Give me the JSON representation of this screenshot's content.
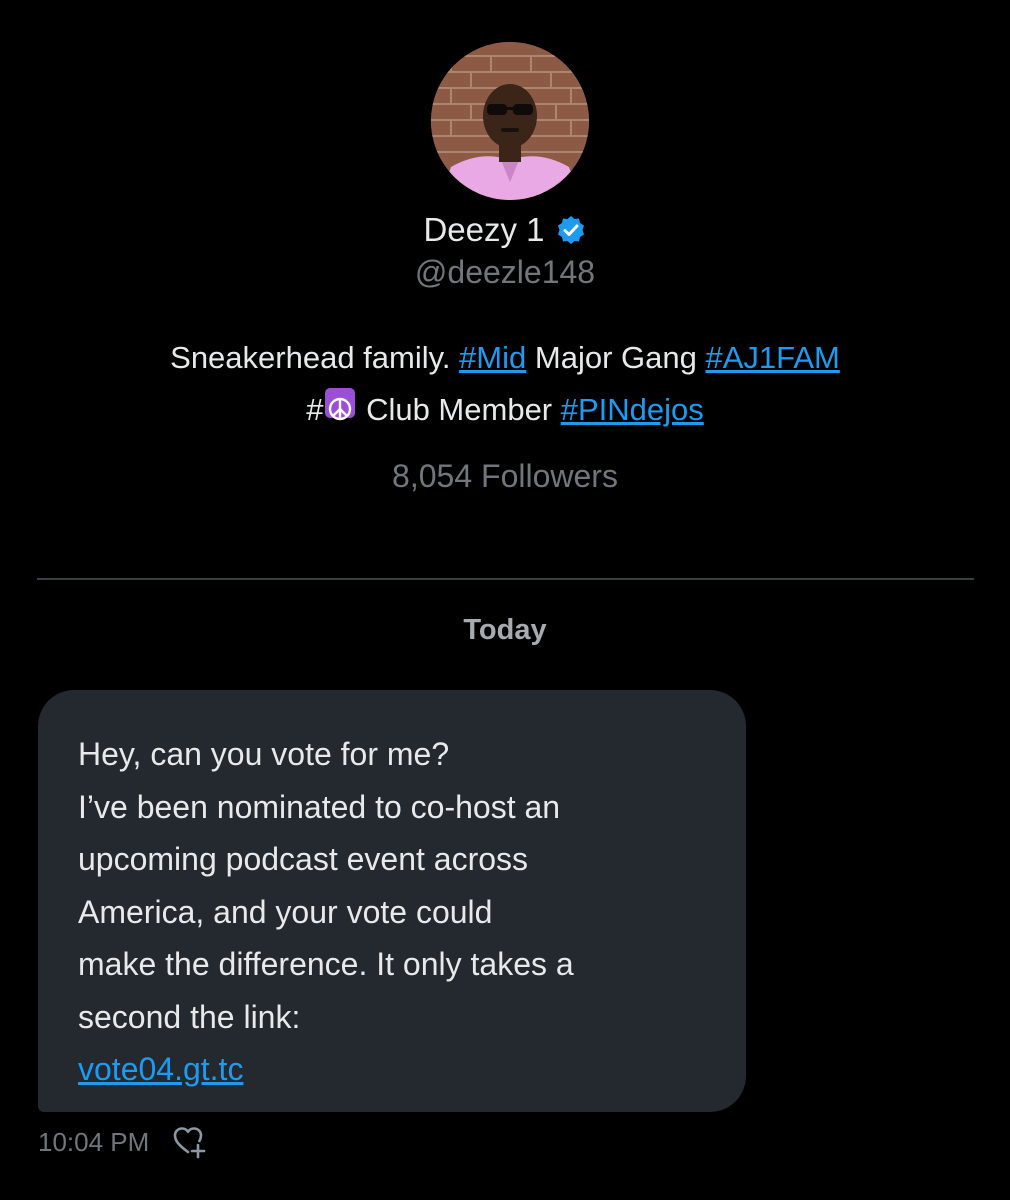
{
  "profile": {
    "display_name": "Deezy 1",
    "handle": "@deezle148",
    "verified_icon": "verified-badge-icon",
    "bio": {
      "text1": "Sneakerhead family. ",
      "tag_mid": "#Mid",
      "text2": " Major Gang ",
      "tag_aj1fam": "#AJ1FAM",
      "text3": "#",
      "emoji": "peace-symbol-icon",
      "text4": " Club Member ",
      "tag_pindejos": "#PINdejos"
    },
    "followers": "8,054 Followers"
  },
  "conversation": {
    "date_label": "Today",
    "message": {
      "lines": [
        "Hey, can you vote for me?",
        "I’ve been nominated to co-host an",
        "upcoming podcast event across",
        "America, and your vote could",
        "make the difference. It only takes a",
        "second the link:"
      ],
      "link": "vote04.gt.tc",
      "time": "10:04 PM",
      "react_icon": "heart-plus-icon"
    }
  },
  "colors": {
    "background": "#000000",
    "bubble": "#23292f",
    "link": "#1d9bf0",
    "muted": "#71767b",
    "verified": "#1d9bf0",
    "peace_bg": "#9b4fd6"
  }
}
